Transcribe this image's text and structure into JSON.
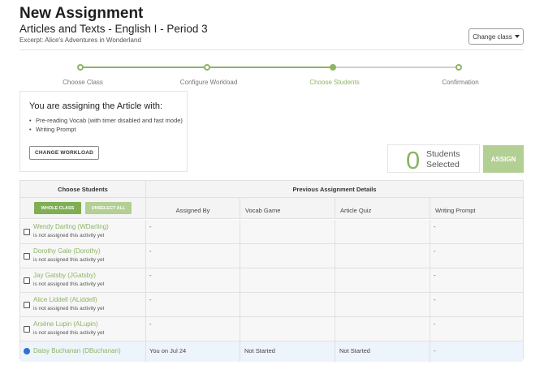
{
  "header": {
    "title": "New Assignment",
    "subtitle": "Articles and Texts - English I - Period 3",
    "excerpt": "Excerpt: Alice's Adventures in Wonderland",
    "change_class_label": "Change class"
  },
  "colors": {
    "accent": "#8cb564",
    "accent_light": "#b2cf94",
    "selected_row": "#eef4fc",
    "radio": "#2f6fd6"
  },
  "steps": [
    {
      "label": "Choose Class",
      "state": "done"
    },
    {
      "label": "Configure Workload",
      "state": "done"
    },
    {
      "label": "Choose Students",
      "state": "active"
    },
    {
      "label": "Confirmation",
      "state": "pending"
    }
  ],
  "info": {
    "heading": "You are assigning the Article with:",
    "items": [
      "Pre-reading Vocab (with timer disabled and fast mode)",
      "Writing Prompt"
    ],
    "change_workload_label": "CHANGE WORKLOAD"
  },
  "selection": {
    "count": "0",
    "label_line1": "Students",
    "label_line2": "Selected",
    "assign_label": "ASSIGN"
  },
  "table": {
    "choose_students_header": "Choose Students",
    "previous_header": "Previous Assignment Details",
    "whole_class_label": "WHOLE CLASS",
    "unselect_all_label": "UNSELECT ALL",
    "columns": [
      "Assigned By",
      "Vocab Game",
      "Article Quiz",
      "Writing Prompt"
    ],
    "rows": [
      {
        "name": "Wendy Darling (WDarling)",
        "note": "is not assigned this activity yet",
        "assigned_by": "-",
        "vocab": "",
        "quiz": "",
        "writing": "-"
      },
      {
        "name": "Dorothy Gale (Dorothy)",
        "note": "is not assigned this activity yet",
        "assigned_by": "-",
        "vocab": "",
        "quiz": "",
        "writing": "-"
      },
      {
        "name": "Jay Gatsby (JGatsby)",
        "note": "is not assigned this activity yet",
        "assigned_by": "-",
        "vocab": "",
        "quiz": "",
        "writing": "-"
      },
      {
        "name": "Alice Liddell (ALiddell)",
        "note": "is not assigned this activity yet",
        "assigned_by": "-",
        "vocab": "",
        "quiz": "",
        "writing": "-"
      },
      {
        "name": "Arsène Lupin (ALupin)",
        "note": "is not assigned this activity yet",
        "assigned_by": "-",
        "vocab": "",
        "quiz": "",
        "writing": "-"
      },
      {
        "name": "Daisy Buchanan (DBuchanan)",
        "note": "",
        "assigned_by": "You on Jul 24",
        "vocab": "Not Started",
        "quiz": "Not Started",
        "writing": "-"
      }
    ]
  }
}
